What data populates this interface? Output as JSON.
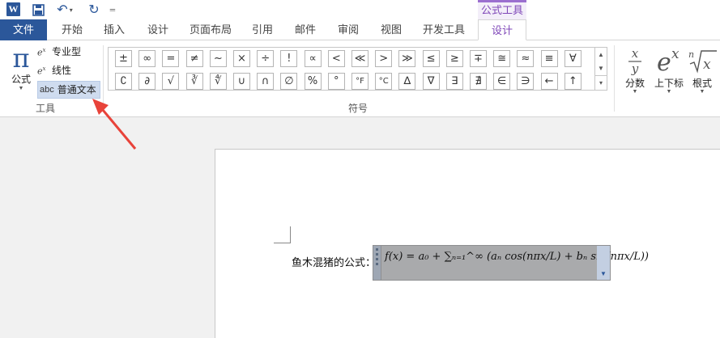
{
  "qat": {
    "word_logo": "W",
    "save_icon": "save-icon",
    "undo_icon": "undo-icon",
    "redo_icon": "redo-icon"
  },
  "context_group": "公式工具",
  "tabs": [
    "文件",
    "开始",
    "插入",
    "设计",
    "页面布局",
    "引用",
    "邮件",
    "审阅",
    "视图",
    "开发工具"
  ],
  "context_tab": "设计",
  "tools_group": {
    "formula_label": "公式",
    "items": [
      "专业型",
      "线性",
      "普通文本"
    ],
    "abc_text": "abc",
    "label": "工具"
  },
  "symbols_group": {
    "label": "符号",
    "row1": [
      "±",
      "∞",
      "=",
      "≠",
      "~",
      "×",
      "÷",
      "!",
      "∝",
      "<",
      "≪",
      ">",
      "≫",
      "≤",
      "≥",
      "∓",
      "≅",
      "≈",
      "≡",
      "∀"
    ],
    "row2": [
      "∁",
      "∂",
      "√",
      "∛",
      "∜",
      "∪",
      "∩",
      "∅",
      "%",
      "°",
      "°F",
      "°C",
      "∆",
      "∇",
      "∃",
      "∄",
      "∈",
      "∋",
      "←",
      "↑"
    ]
  },
  "structures": [
    {
      "label": "分数"
    },
    {
      "label": "上下标"
    },
    {
      "label": "根式"
    }
  ],
  "document": {
    "body_text": "鱼木混猪的公式：",
    "equation": "f(x) = a₀ + ∑ₙ₌₁^∞ (aₙ cos(nπx/L) + bₙ sin(nπx/L))"
  },
  "colors": {
    "accent": "#2b579a",
    "context": "#7f47b8",
    "annotation": "#e8433a"
  }
}
